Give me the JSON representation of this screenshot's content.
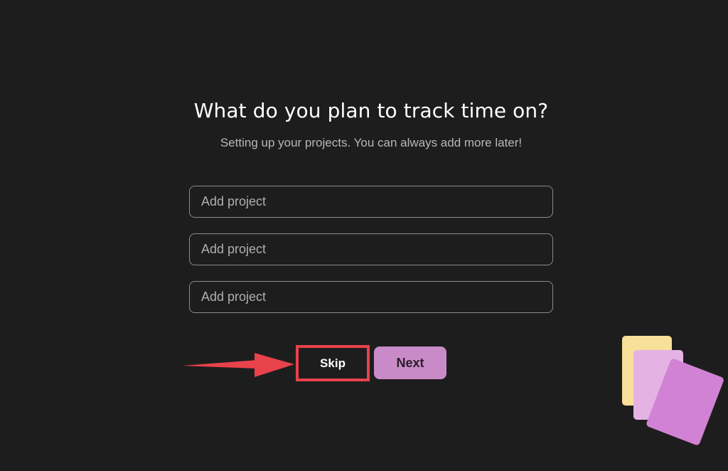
{
  "onboarding": {
    "title": "What do you plan to track time on?",
    "subtitle": "Setting up your projects. You can always add more later!",
    "project_inputs": [
      {
        "placeholder": "Add project",
        "value": ""
      },
      {
        "placeholder": "Add project",
        "value": ""
      },
      {
        "placeholder": "Add project",
        "value": ""
      }
    ],
    "skip_label": "Skip",
    "next_label": "Next"
  },
  "annotation": {
    "highlight_color": "#e8424a",
    "arrow_icon": "red-arrow-right"
  },
  "illustration": {
    "cards": [
      "yellow-card",
      "light-pink-card",
      "pink-card"
    ],
    "colors": [
      "#f8df9a",
      "#e4b3e3",
      "#d282d4"
    ]
  },
  "colors": {
    "background": "#1e1d1e",
    "accent": "#c98bc8",
    "input_border": "#8c8a8b"
  }
}
